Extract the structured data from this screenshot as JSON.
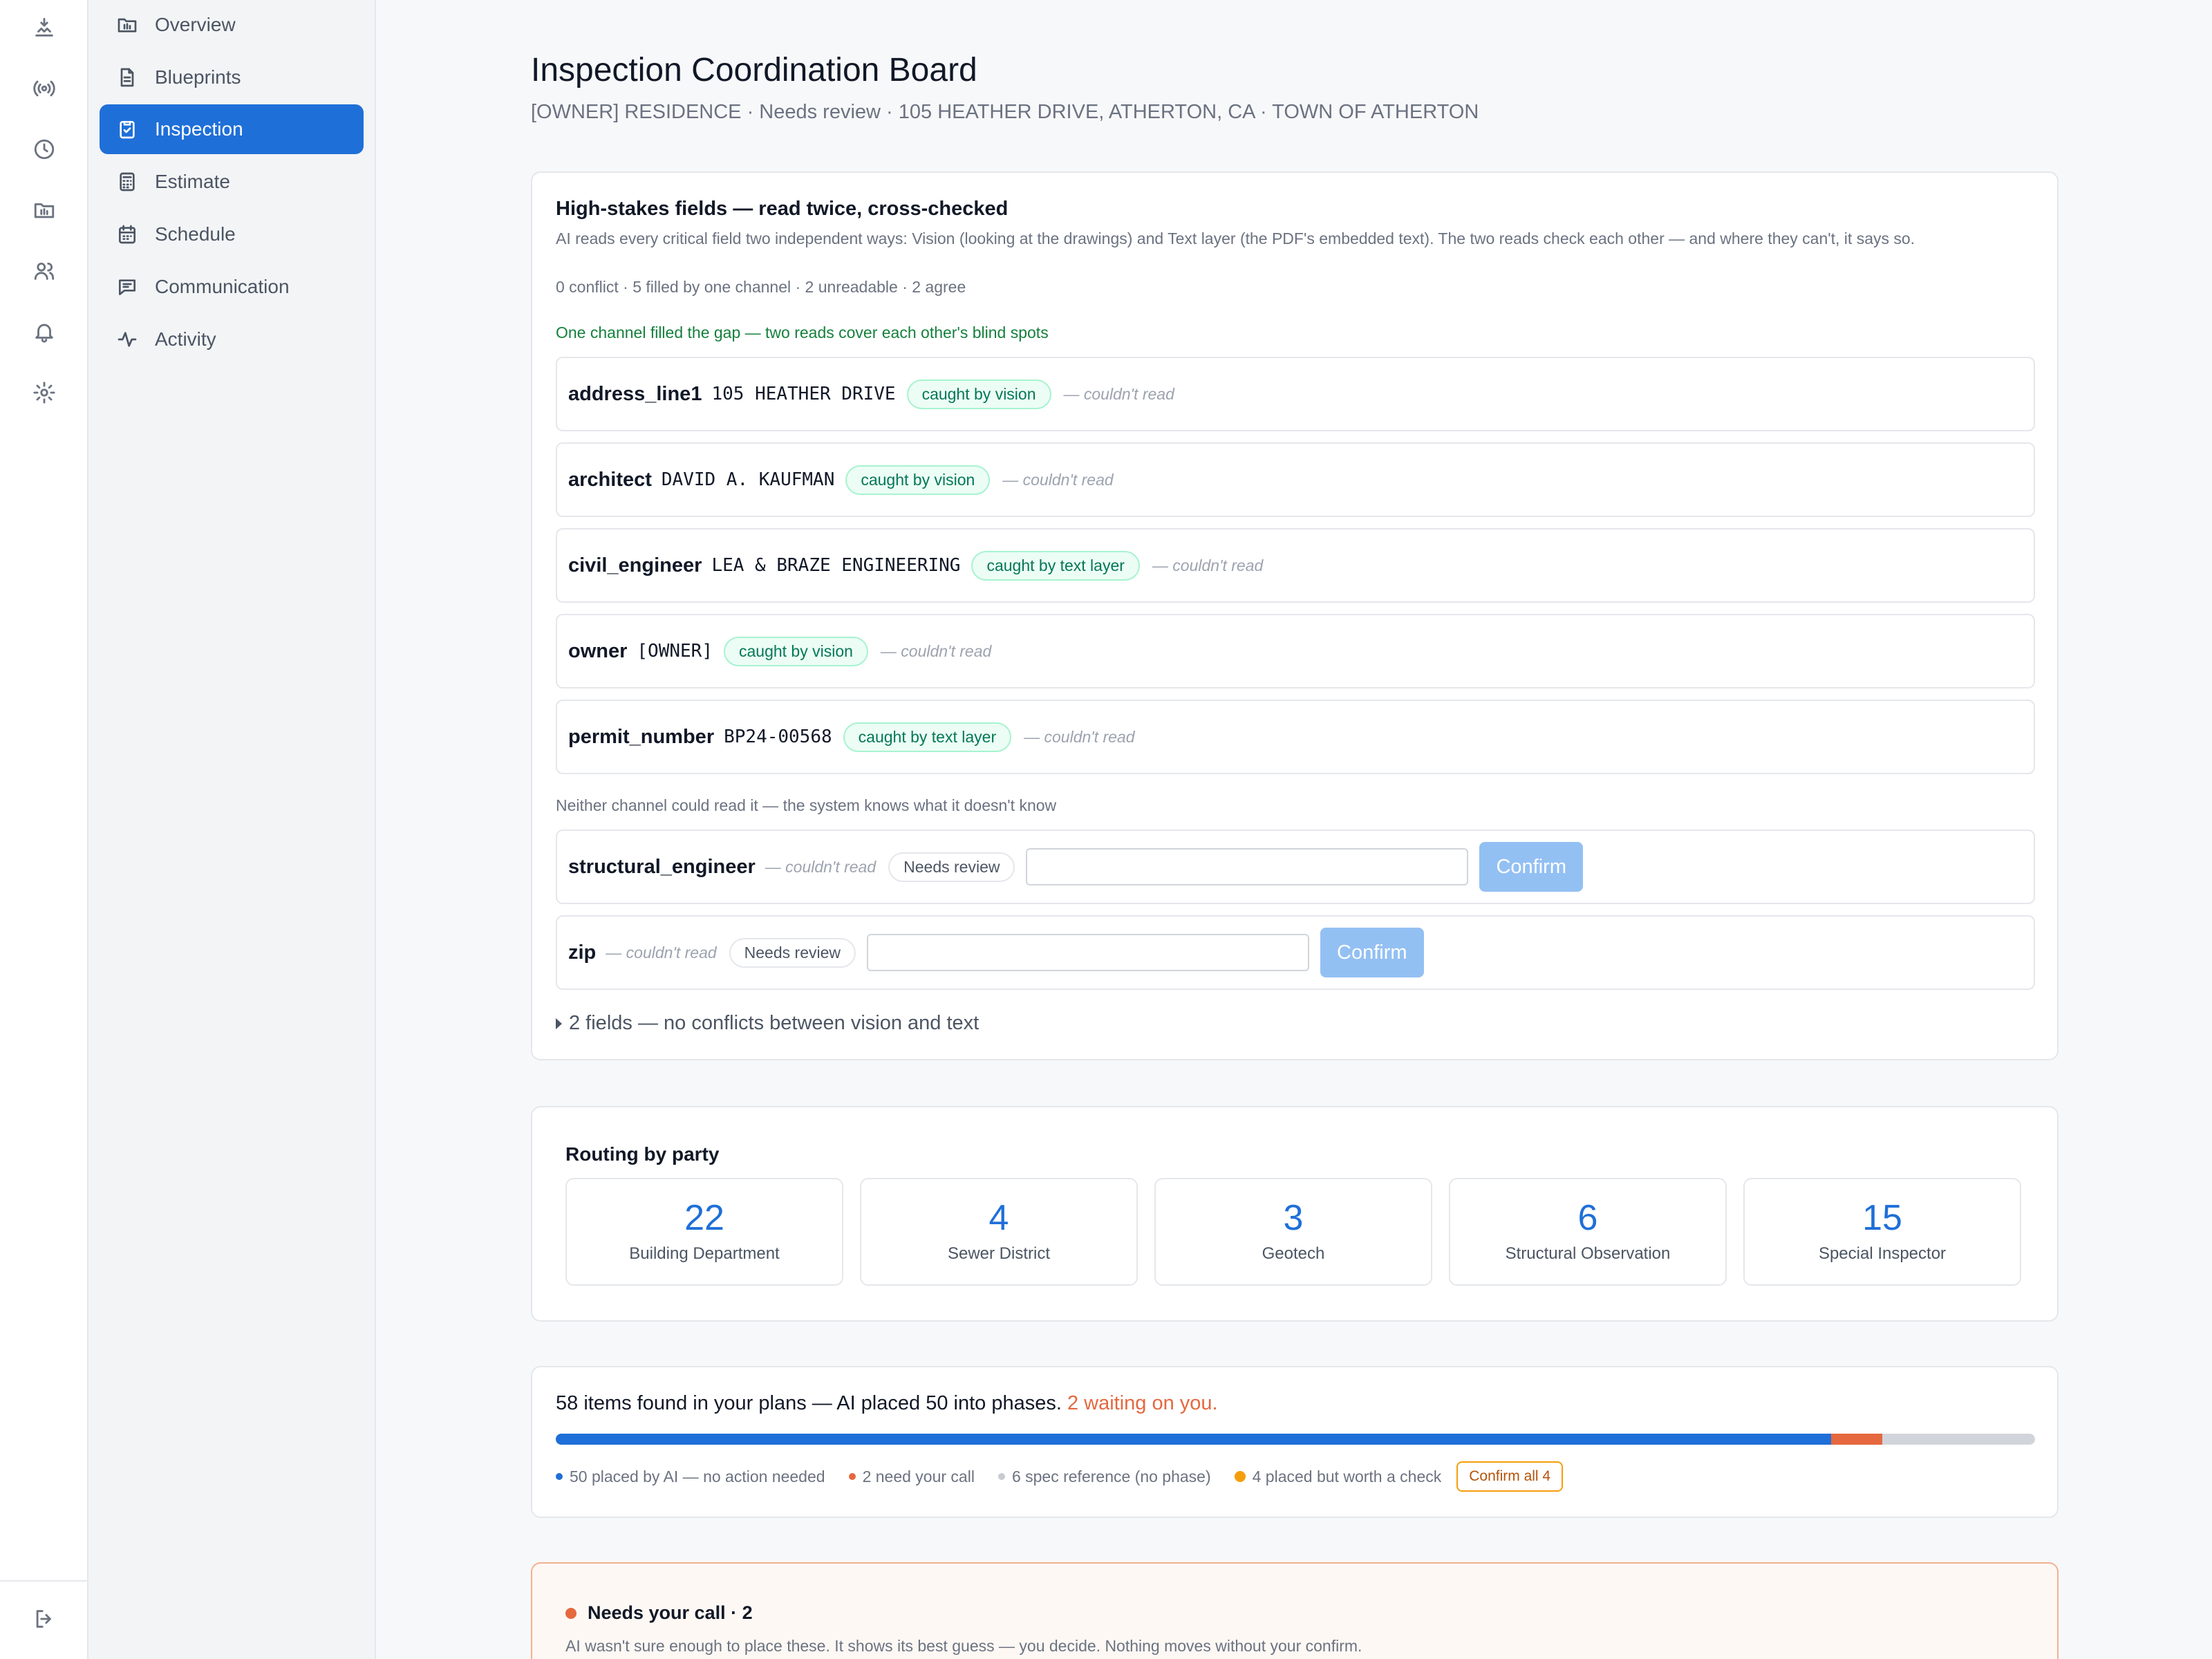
{
  "rail": {
    "icons": [
      "site-icon",
      "broadcast-icon",
      "clock-icon",
      "folder-icon",
      "users-icon",
      "bell-icon",
      "gear-icon",
      "logout-icon"
    ]
  },
  "sidebar": {
    "items": [
      {
        "label": "Overview",
        "icon": "folder-icon"
      },
      {
        "label": "Blueprints",
        "icon": "document-icon"
      },
      {
        "label": "Inspection",
        "icon": "clipboard-icon",
        "active": true
      },
      {
        "label": "Estimate",
        "icon": "calculator-icon"
      },
      {
        "label": "Schedule",
        "icon": "calendar-icon"
      },
      {
        "label": "Communication",
        "icon": "chat-icon"
      },
      {
        "label": "Activity",
        "icon": "activity-icon"
      }
    ]
  },
  "header": {
    "title": "Inspection Coordination Board",
    "subtitle": "[OWNER] RESIDENCE · Needs review · 105 HEATHER DRIVE, ATHERTON, CA · TOWN OF ATHERTON"
  },
  "fields_card": {
    "title": "High-stakes fields — read twice, cross-checked",
    "description": "AI reads every critical field two independent ways: Vision (looking at the drawings) and Text layer (the PDF's embedded text). The two reads check each other — and where they can't, it says so.",
    "stats": "0 conflict · 5 filled by one channel · 2 unreadable · 2 agree",
    "filled_heading": "One channel filled the gap — two reads cover each other's blind spots",
    "filled": [
      {
        "name": "address_line1",
        "value": "105 HEATHER DRIVE",
        "badge": "caught by vision",
        "note": "— couldn't read"
      },
      {
        "name": "architect",
        "value": "DAVID A. KAUFMAN",
        "badge": "caught by vision",
        "note": "— couldn't read"
      },
      {
        "name": "civil_engineer",
        "value": "LEA & BRAZE ENGINEERING",
        "badge": "caught by text layer",
        "note": "— couldn't read"
      },
      {
        "name": "owner",
        "value": "[OWNER]",
        "badge": "caught by vision",
        "note": "— couldn't read"
      },
      {
        "name": "permit_number",
        "value": "BP24-00568",
        "badge": "caught by text layer",
        "note": "— couldn't read"
      }
    ],
    "unread_heading": "Neither channel could read it — the system knows what it doesn't know",
    "unread": [
      {
        "name": "structural_engineer",
        "note": "— couldn't read",
        "badge": "Needs review",
        "input_value": "",
        "confirm": "Confirm"
      },
      {
        "name": "zip",
        "note": "— couldn't read",
        "badge": "Needs review",
        "input_value": "",
        "confirm": "Confirm"
      }
    ],
    "agree_summary": "2 fields — no conflicts between vision and text"
  },
  "routing": {
    "title": "Routing by party",
    "parties": [
      {
        "count": "22",
        "label": "Building Department"
      },
      {
        "count": "4",
        "label": "Sewer District"
      },
      {
        "count": "3",
        "label": "Geotech"
      },
      {
        "count": "6",
        "label": "Structural Observation"
      },
      {
        "count": "15",
        "label": "Special Inspector"
      }
    ]
  },
  "placement": {
    "headline": "58 items found in your plans — AI placed 50 into phases.",
    "headline_warn": "2 waiting on you.",
    "progress": {
      "total": 58,
      "placed": 50,
      "need_call": 2,
      "spec_reference": 6
    },
    "legend": [
      {
        "text": "50 placed by AI — no action needed",
        "color": "#1f6fd8"
      },
      {
        "text": "2 need your call",
        "color": "#e5683f"
      },
      {
        "text": "6 spec reference (no phase)",
        "color": "#c7cbd1"
      },
      {
        "text": "4 placed but worth a check",
        "color": "#f59e0b"
      }
    ],
    "confirm_all": "Confirm all 4"
  },
  "needs_call": {
    "title": "Needs your call · 2",
    "description": "AI wasn't sure enough to place these. It shows its best guess — you decide. Nothing moves without your confirm."
  },
  "colors": {
    "accent": "#1f6fd8",
    "warning": "#e5683f",
    "success": "#047857"
  }
}
